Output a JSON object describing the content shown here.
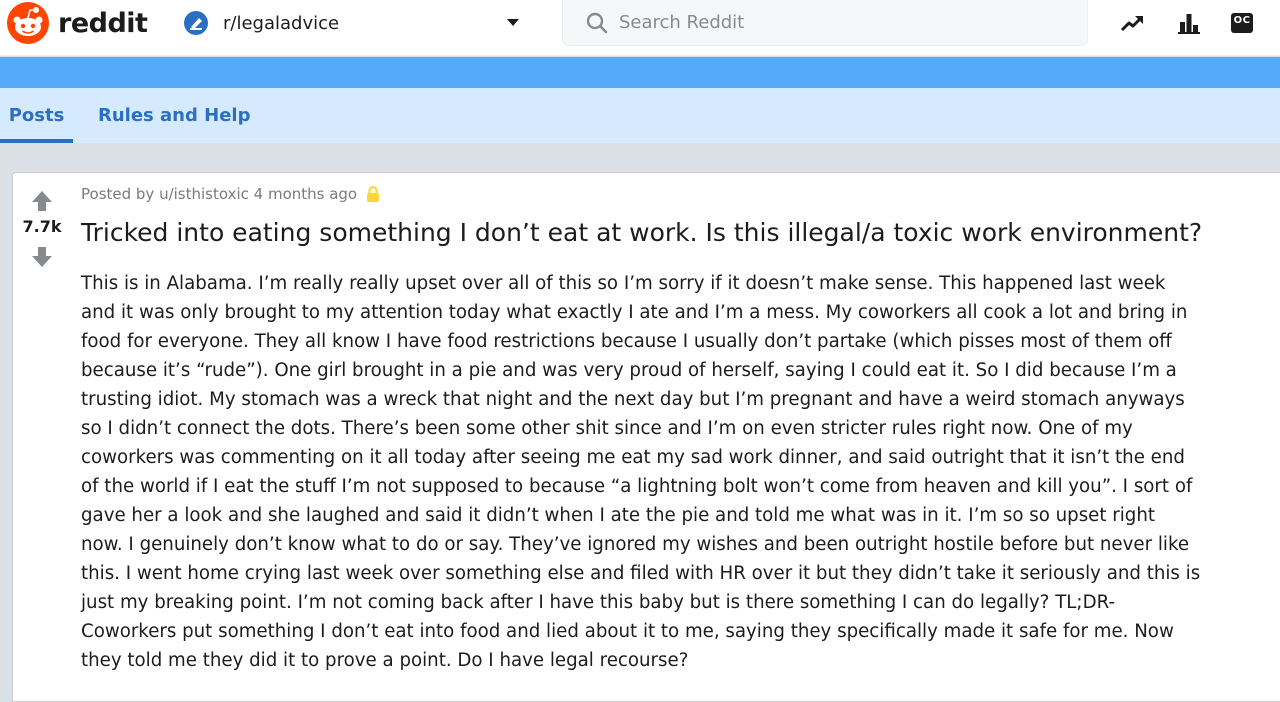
{
  "header": {
    "brand": "reddit",
    "community": "r/legaladvice",
    "search_placeholder": "Search Reddit",
    "icons": [
      "popular-icon",
      "all-icon",
      "oc-icon"
    ],
    "oc_label": "OC"
  },
  "nav": {
    "tabs": [
      {
        "label": "Posts",
        "active": true
      },
      {
        "label": "Rules and Help",
        "active": false
      }
    ]
  },
  "post": {
    "score": "7.7k",
    "meta": "Posted by u/isthistoxic 4 months ago",
    "title": "Tricked into eating something I don’t eat at work. Is this illegal/a toxic work environment?",
    "body": "This is in Alabama. I’m really really upset over all of this so I’m sorry if it doesn’t make sense. This happened last week and it was only brought to my attention today what exactly I ate and I’m a mess. My coworkers all cook a lot and bring in food for everyone. They all know I have food restrictions because I usually don’t partake (which pisses most of them off because it’s “rude”). One girl brought in a pie and was very proud of herself, saying I could eat it. So I did because I’m a trusting idiot. My stomach was a wreck that night and the next day but I’m pregnant and have a weird stomach anyways so I didn’t connect the dots. There’s been some other shit since and I’m on even stricter rules right now. One of my coworkers was commenting on it all today after seeing me eat my sad work dinner, and said outright that it isn’t the end of the world if I eat the stuff I’m not supposed to because “a lightning bolt won’t come from heaven and kill you”. I sort of gave her a look and she laughed and said it didn’t when I ate the pie and told me what was in it. I’m so so upset right now. I genuinely don’t know what to do or say. They’ve ignored my wishes and been outright hostile before but never like this. I went home crying last week over something else and filed with HR over it but they didn’t take it seriously and this is just my breaking point. I’m not coming back after I have this baby but is there something I can do legally? TL;DR- Coworkers put something I don’t eat into food and lied about it to me, saying they specifically made it safe for me. Now they told me they did it to prove a point. Do I have legal recourse?"
  },
  "colors": {
    "reddit_orange": "#ff4500",
    "banner_blue": "#54a9f9",
    "nav_bg": "#d6eaff",
    "nav_text": "#2b6fc1",
    "page_bg": "#dae0e6",
    "lock_gold": "#ffd635"
  }
}
